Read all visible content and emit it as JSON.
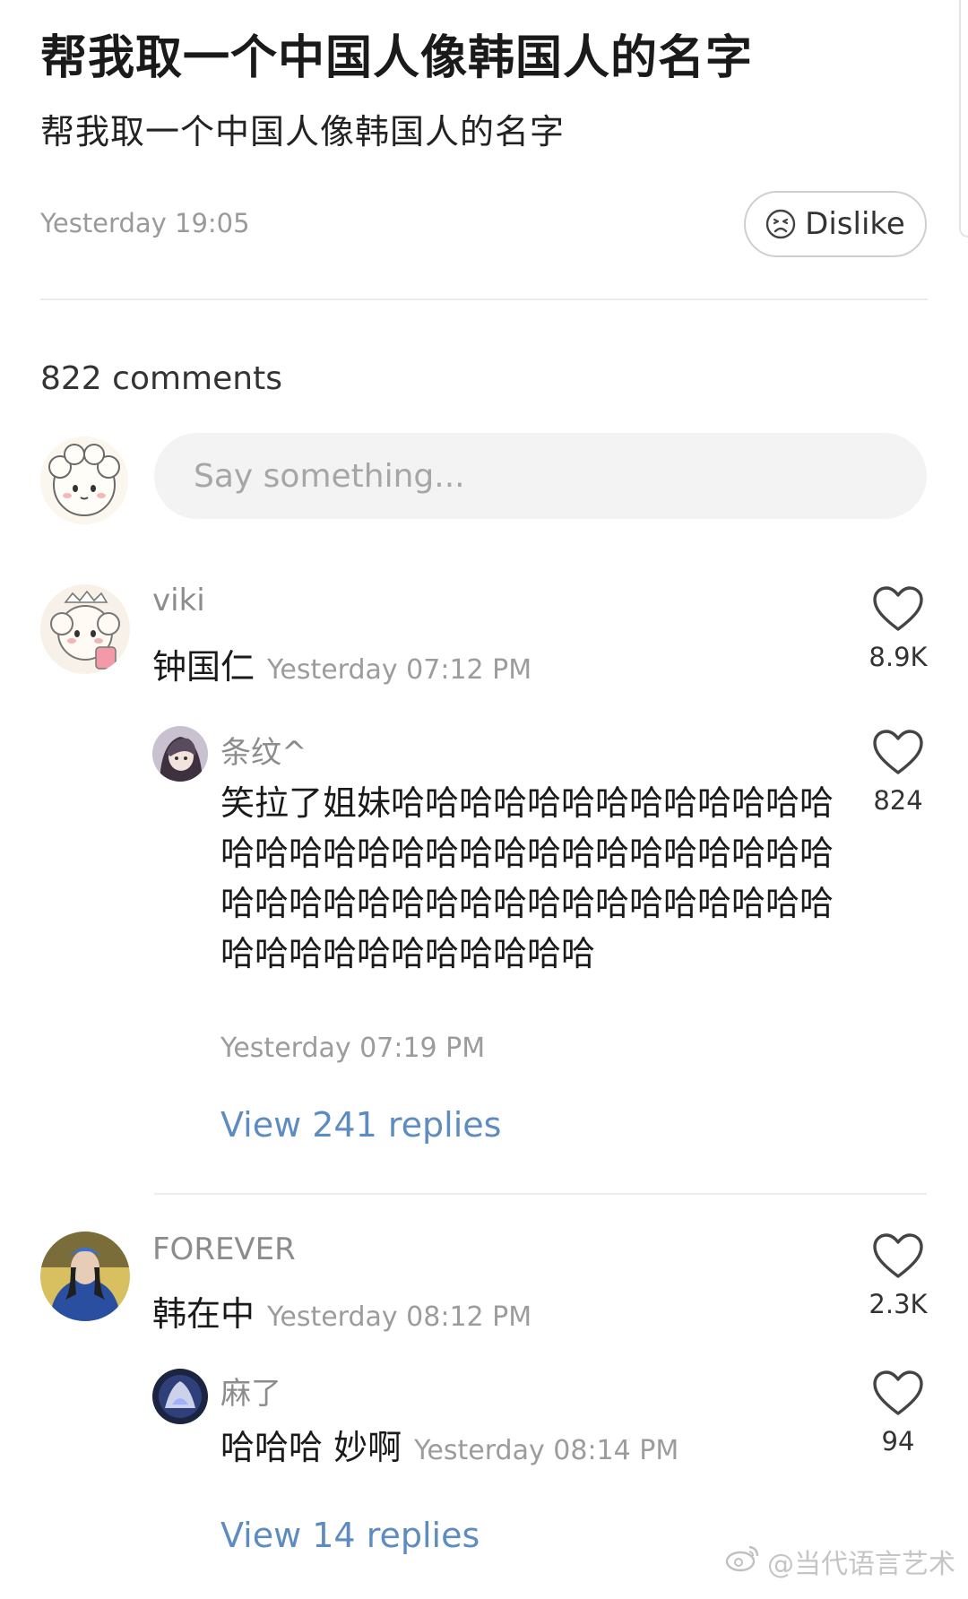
{
  "post": {
    "title": "帮我取一个中国人像韩国人的名字",
    "body": "帮我取一个中国人像韩国人的名字",
    "time": "Yesterday 19:05",
    "dislike_label": "Dislike"
  },
  "comments_header": {
    "count_label": "822  comments"
  },
  "composer": {
    "placeholder": "Say something..."
  },
  "comments": [
    {
      "user": "viki",
      "text": "钟国仁",
      "time": "Yesterday 07:12 PM",
      "likes": "8.9K",
      "reply": {
        "user": "条纹^",
        "text": "笑拉了姐妹哈哈哈哈哈哈哈哈哈哈哈哈哈哈哈哈哈哈哈哈哈哈哈哈哈哈哈哈哈哈哈哈哈哈哈哈哈哈哈哈哈哈哈哈哈哈哈哈哈哈哈哈哈哈哈哈哈哈哈哈",
        "time": "Yesterday 07:19 PM",
        "likes": "824"
      },
      "view_replies": "View 241 replies"
    },
    {
      "user": "FOREVER",
      "text": "韩在中",
      "time": "Yesterday 08:12 PM",
      "likes": "2.3K",
      "reply": {
        "user": "麻了",
        "text": "哈哈哈 妙啊",
        "time": "Yesterday 08:14 PM",
        "likes": "94"
      },
      "view_replies": "View 14 replies"
    }
  ],
  "watermark": "@当代语言艺术",
  "icons": {
    "dislike": "frown-face-icon",
    "like": "heart-outline-icon",
    "watermark_logo": "weibo-logo-icon"
  }
}
